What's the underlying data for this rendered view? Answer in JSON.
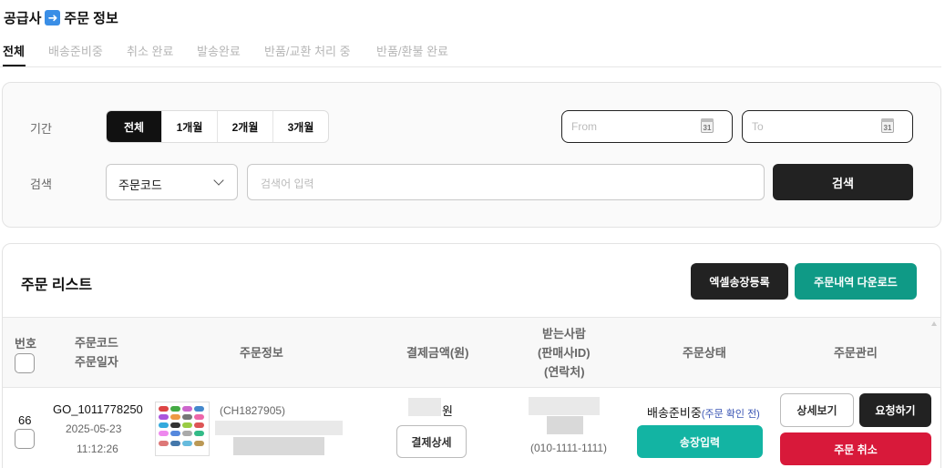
{
  "header": {
    "title_left": "공급사",
    "title_right": "주문 정보"
  },
  "tabs": [
    {
      "label": "전체",
      "active": true
    },
    {
      "label": "배송준비중"
    },
    {
      "label": "취소 완료"
    },
    {
      "label": "발송완료"
    },
    {
      "label": "반품/교환 처리 중"
    },
    {
      "label": "반품/환불 완료"
    }
  ],
  "filter": {
    "period_label": "기간",
    "periods": [
      "전체",
      "1개월",
      "2개월",
      "3개월"
    ],
    "date_from_placeholder": "From",
    "date_to_placeholder": "To",
    "calendar_day": "31",
    "search_label": "검색",
    "search_type": "주문코드",
    "search_placeholder": "검색어 입력",
    "search_button": "검색"
  },
  "list": {
    "title": "주문 리스트",
    "excel_button": "엑셀송장등록",
    "download_button": "주문내역 다운로드",
    "columns": {
      "number": "번호",
      "code": "주문코드",
      "date": "주문일자",
      "info": "주문정보",
      "amount": "결제금액(원)",
      "receiver1": "받는사람",
      "receiver2": "(판매사ID)",
      "receiver3": "(연락처)",
      "status": "주문상태",
      "manage": "주문관리"
    },
    "rows": [
      {
        "number": "66",
        "code": "GO_1011778250",
        "date": "2025-05-23",
        "time": "11:12:26",
        "product_code": "(CH1827905)",
        "amount_suffix": "원",
        "pay_detail": "결제상세",
        "phone": "(010-1111-1111)",
        "status": "배송준비중",
        "status_note": "(주문 확인 전)",
        "invoice_button": "송장입력",
        "detail_button": "상세보기",
        "request_button": "요청하기",
        "cancel_button": "주문 취소"
      }
    ]
  },
  "colors": {
    "accent": "#0f9a86",
    "teal_button": "#13b4a3",
    "danger": "#d8193a",
    "dark": "#222222"
  }
}
